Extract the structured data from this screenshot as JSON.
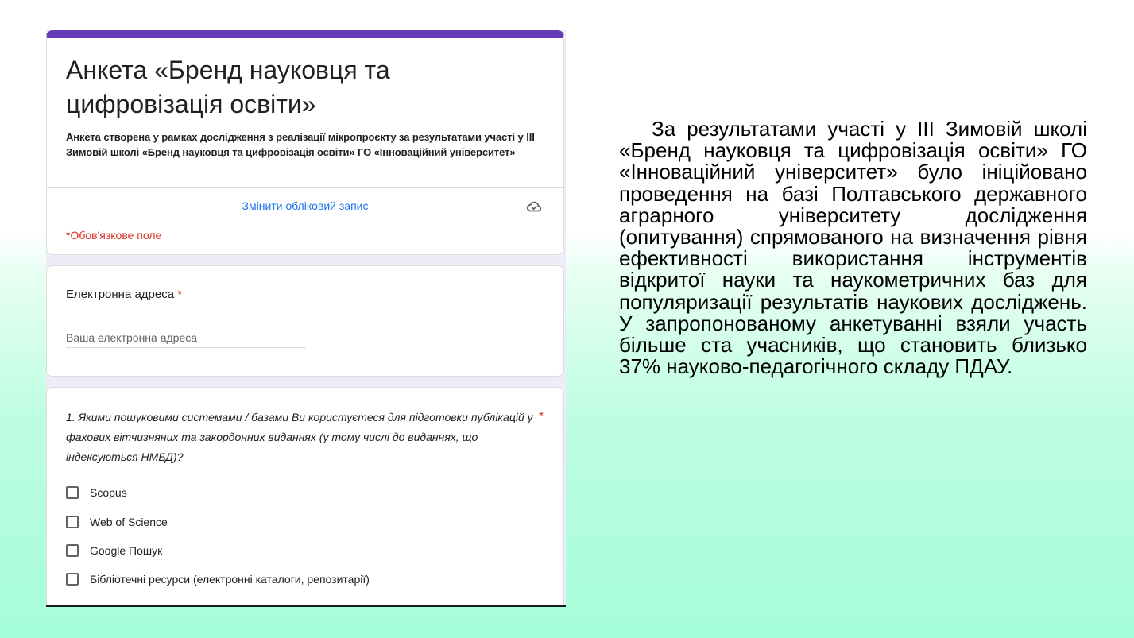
{
  "form": {
    "accent_color": "#673ab7",
    "title": "Анкета «Бренд науковця та цифровізація освіти»",
    "description": "Анкета створена у рамках дослідження з реалізації мікропроєкту за результатами участі у ІІІ Зимовій школі «Бренд науковця та цифровізація освіти» ГО «Інноваційний університет»",
    "switch_account_label": "Змінити обліковий запис",
    "cloud_icon": "cloud-saved-icon",
    "required_note": "*Обов'язкове поле",
    "email": {
      "label": "Електронна адреса",
      "required_mark": "*",
      "placeholder": "Ваша електронна адреса"
    },
    "question1": {
      "text": "1. Якими пошуковими системами / базами Ви користуєтеся для підготовки публікацій у фахових вітчизняних та закордонних виданнях (у тому числі до виданнях, що індексуються НМБД)?",
      "required_mark": "*",
      "options": [
        "Scopus",
        "Web of Science",
        "Google Пошук",
        "Бібліотечні ресурси (електронні каталоги, репозитарії)"
      ]
    }
  },
  "side_text": "За результатами участі у ІІІ Зимовій школі «Бренд науковця та цифровізація освіти» ГО «Інноваційний університет» було ініційовано проведення на базі Полтавського державного аграрного університету дослідження (опитування) спрямованого на визначення рівня ефективності використання інструментів відкритої науки та наукометричних баз для популяризації результатів наукових досліджень. У запропонованому анкетуванні взяли участь більше ста учасників, що становить близько 37% науково-педагогічного складу ПДАУ."
}
